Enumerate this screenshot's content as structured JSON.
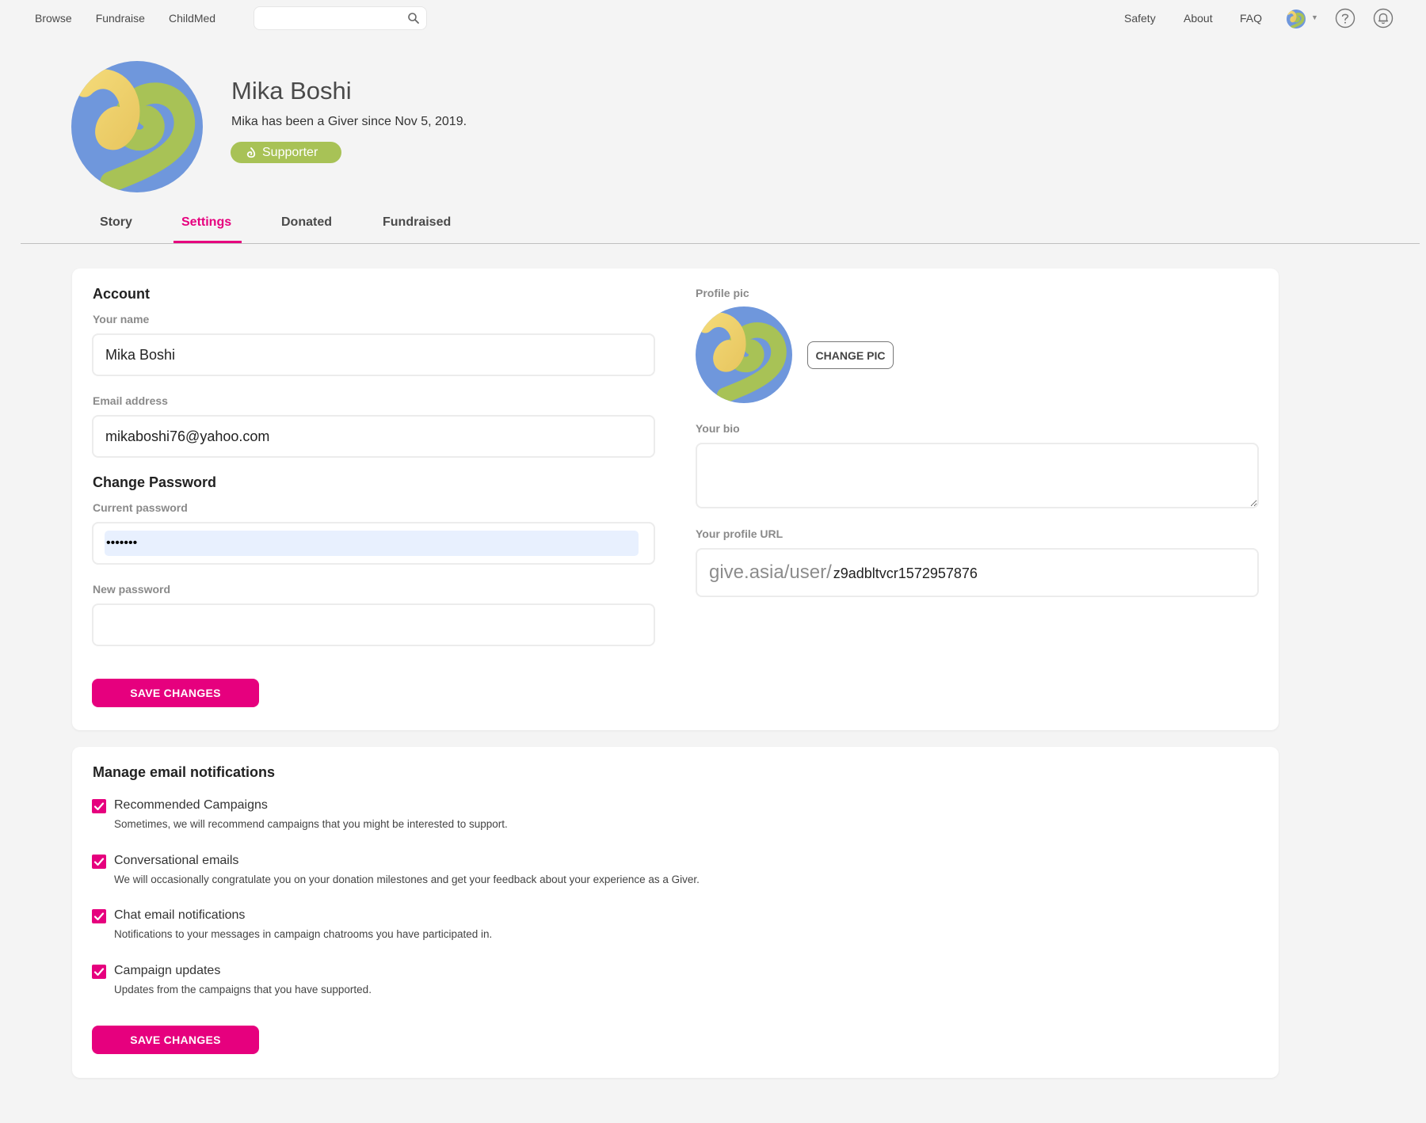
{
  "nav": {
    "browse": "Browse",
    "fundraise": "Fundraise",
    "childmed": "ChildMed",
    "search_placeholder": "",
    "safety": "Safety",
    "about": "About",
    "faq": "FAQ"
  },
  "profile": {
    "name": "Mika Boshi",
    "since": "Mika has been a Giver since Nov 5, 2019.",
    "badge": "Supporter"
  },
  "tabs": [
    {
      "label": "Story"
    },
    {
      "label": "Settings",
      "active": true
    },
    {
      "label": "Donated"
    },
    {
      "label": "Fundraised"
    }
  ],
  "account": {
    "title": "Account",
    "name_label": "Your name",
    "name_value": "Mika Boshi",
    "email_label": "Email address",
    "email_value": "mikaboshi76@yahoo.com",
    "pw_title": "Change Password",
    "current_pw_label": "Current password",
    "current_pw_value": "•••••••",
    "new_pw_label": "New password",
    "new_pw_value": "",
    "save_label": "SAVE CHANGES",
    "pic_label": "Profile pic",
    "change_pic_label": "CHANGE PIC",
    "bio_label": "Your bio",
    "bio_value": "",
    "url_label": "Your profile URL",
    "url_prefix": "give.asia/user/",
    "url_value": "z9adbltvcr1572957876"
  },
  "notifications": {
    "title": "Manage email notifications",
    "items": [
      {
        "title": "Recommended Campaigns",
        "desc": "Sometimes, we will recommend campaigns that you might be interested to support.",
        "checked": true
      },
      {
        "title": "Conversational emails",
        "desc": "We will occasionally congratulate you on your donation milestones and get your feedback about your experience as a Giver.",
        "checked": true
      },
      {
        "title": "Chat email notifications",
        "desc": "Notifications to your messages in campaign chatrooms you have participated in.",
        "checked": true
      },
      {
        "title": "Campaign updates",
        "desc": "Updates from the campaigns that you have supported.",
        "checked": true
      }
    ],
    "save_label": "SAVE CHANGES"
  },
  "colors": {
    "accent": "#e6007e",
    "badge": "#a8c256",
    "avatar_blue": "#6f97dc",
    "avatar_green": "#a8c256",
    "avatar_yellow": "#f0d272"
  },
  "icons": {
    "search": "search-icon",
    "help": "question-circle-icon",
    "bell": "bell-icon",
    "caret": "caret-down-icon",
    "check": "checkmark-icon"
  }
}
